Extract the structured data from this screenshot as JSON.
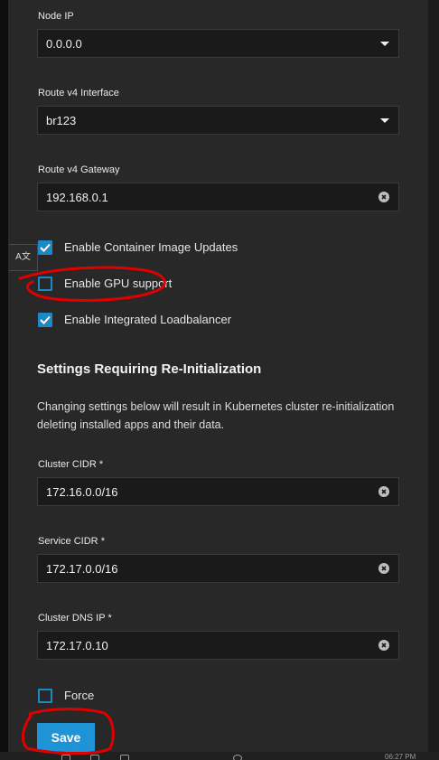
{
  "fields": {
    "node_ip": {
      "label": "Node IP",
      "value": "0.0.0.0"
    },
    "route_v4_interface": {
      "label": "Route v4 Interface",
      "value": "br123"
    },
    "route_v4_gateway": {
      "label": "Route v4 Gateway",
      "value": "192.168.0.1"
    },
    "cluster_cidr": {
      "label": "Cluster CIDR",
      "required_mark": "*",
      "value": "172.16.0.0/16"
    },
    "service_cidr": {
      "label": "Service CIDR",
      "required_mark": "*",
      "value": "172.17.0.0/16"
    },
    "cluster_dns_ip": {
      "label": "Cluster DNS IP",
      "required_mark": "*",
      "value": "172.17.0.10"
    }
  },
  "checkboxes": {
    "container_image_updates": {
      "label": "Enable Container Image Updates",
      "checked": true
    },
    "gpu_support": {
      "label": "Enable GPU support",
      "checked": false
    },
    "integrated_loadbalancer": {
      "label": "Enable Integrated Loadbalancer",
      "checked": true
    },
    "force": {
      "label": "Force",
      "checked": false
    }
  },
  "section": {
    "title": "Settings Requiring Re-Initialization",
    "description": "Changing settings below will result in Kubernetes cluster re-initialization deleting installed apps and their data."
  },
  "actions": {
    "save_label": "Save"
  },
  "translate_widget": {
    "label": "A文"
  },
  "taskbar": {
    "clock_text": "06:27 PM"
  },
  "colors": {
    "accent": "#1e88c7",
    "save_button": "#1e93d6",
    "panel_bg": "#282828",
    "input_bg": "#1a1a1a",
    "annotation": "#e00000"
  }
}
